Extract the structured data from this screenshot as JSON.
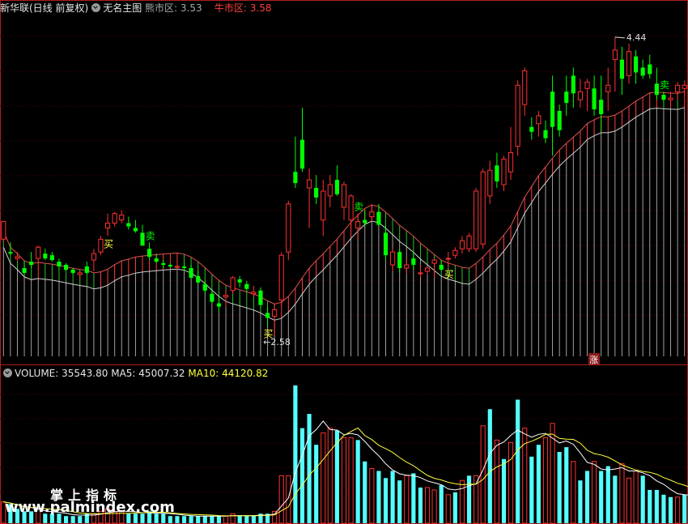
{
  "header": {
    "stock_title": "新华联(日线 前复权)",
    "main_indicator": "无名主图",
    "bear_label": "熊市区:",
    "bear_value": "3.53",
    "bull_label": "牛市区:",
    "bull_value": "3.58"
  },
  "volume_header": {
    "label": "VOLUME:",
    "value": "35543.80",
    "ma5_label": "MA5:",
    "ma5_value": "45007.32",
    "ma10_label": "MA10:",
    "ma10_value": "44120.82"
  },
  "watermark": {
    "line1": "掌上指标",
    "line2": "www.palmindex.com"
  },
  "colors": {
    "up": "#ff3232",
    "down": "#00ff00",
    "vol_down": "#54ffff",
    "ma5": "#ffffff",
    "ma10": "#ffff3c",
    "frame": "#b01e1e"
  },
  "chart_data": {
    "type": "candlestick",
    "price_range": [
      2.5,
      4.5
    ],
    "annotations": {
      "high_label": "4.44",
      "low_label": "2.58",
      "buy": "买",
      "sell": "卖",
      "rise": "涨"
    },
    "signals": [
      {
        "type": "buy",
        "bar": 15
      },
      {
        "type": "sell",
        "bar": 21
      },
      {
        "type": "buy",
        "bar": 38
      },
      {
        "type": "sell",
        "bar": 51
      },
      {
        "type": "buy",
        "bar": 64
      },
      {
        "type": "sell",
        "bar": 95
      }
    ],
    "rise_marker_bar": 85,
    "candles": [
      [
        3.18,
        3.29,
        3.16,
        3.29
      ],
      [
        3.1,
        3.16,
        3.08,
        3.09
      ],
      [
        3.06,
        3.1,
        3.04,
        3.07
      ],
      [
        3.0,
        3.04,
        2.96,
        2.97
      ],
      [
        3.04,
        3.1,
        3.0,
        3.02
      ],
      [
        3.06,
        3.14,
        3.03,
        3.13
      ],
      [
        3.09,
        3.12,
        3.05,
        3.06
      ],
      [
        3.08,
        3.1,
        3.04,
        3.05
      ],
      [
        3.04,
        3.06,
        2.99,
        3.01
      ],
      [
        3.02,
        3.03,
        2.98,
        2.99
      ],
      [
        2.99,
        3.0,
        2.96,
        2.97
      ],
      [
        2.96,
        2.98,
        2.93,
        2.97
      ],
      [
        3.01,
        3.04,
        2.96,
        2.97
      ],
      [
        3.05,
        3.12,
        2.98,
        3.09
      ],
      [
        3.1,
        3.2,
        3.08,
        3.18
      ],
      [
        3.25,
        3.34,
        3.2,
        3.28
      ],
      [
        3.28,
        3.35,
        3.26,
        3.34
      ],
      [
        3.3,
        3.36,
        3.28,
        3.33
      ],
      [
        3.28,
        3.32,
        3.24,
        3.26
      ],
      [
        3.25,
        3.3,
        3.22,
        3.23
      ],
      [
        3.22,
        3.27,
        3.18,
        3.14
      ],
      [
        3.12,
        3.16,
        3.05,
        3.07
      ],
      [
        3.06,
        3.09,
        3.03,
        3.04
      ],
      [
        3.03,
        3.05,
        3.0,
        3.02
      ],
      [
        3.02,
        3.03,
        3.0,
        3.01
      ],
      [
        3.01,
        3.02,
        2.99,
        3.01
      ],
      [
        3.01,
        3.03,
        2.98,
        3.0
      ],
      [
        3.0,
        3.02,
        2.93,
        2.94
      ],
      [
        2.95,
        2.98,
        2.9,
        2.91
      ],
      [
        2.9,
        2.92,
        2.84,
        2.86
      ],
      [
        2.84,
        2.87,
        2.78,
        2.79
      ],
      [
        2.78,
        2.82,
        2.73,
        2.76
      ],
      [
        2.82,
        2.86,
        2.76,
        2.83
      ],
      [
        2.86,
        2.95,
        2.84,
        2.94
      ],
      [
        2.93,
        2.95,
        2.88,
        2.91
      ],
      [
        2.9,
        2.92,
        2.85,
        2.87
      ],
      [
        2.84,
        2.89,
        2.82,
        2.85
      ],
      [
        2.86,
        2.88,
        2.75,
        2.77
      ],
      [
        2.72,
        2.76,
        2.64,
        2.69
      ],
      [
        2.7,
        2.78,
        2.58,
        2.74
      ],
      [
        2.8,
        3.1,
        2.76,
        3.08
      ],
      [
        3.1,
        3.42,
        3.05,
        3.4
      ],
      [
        3.6,
        3.82,
        3.5,
        3.53
      ],
      [
        3.8,
        4.0,
        3.6,
        3.62
      ],
      [
        3.5,
        3.62,
        3.25,
        3.55
      ],
      [
        3.5,
        3.58,
        3.4,
        3.44
      ],
      [
        3.3,
        3.55,
        3.2,
        3.48
      ],
      [
        3.45,
        3.58,
        3.38,
        3.52
      ],
      [
        3.55,
        3.64,
        3.45,
        3.46
      ],
      [
        3.38,
        3.54,
        3.3,
        3.52
      ],
      [
        3.3,
        3.46,
        3.24,
        3.45
      ],
      [
        3.25,
        3.34,
        3.18,
        3.29
      ],
      [
        3.3,
        3.36,
        3.26,
        3.28
      ],
      [
        3.32,
        3.4,
        3.29,
        3.35
      ],
      [
        3.35,
        3.4,
        3.26,
        3.27
      ],
      [
        3.22,
        3.27,
        3.05,
        3.08
      ],
      [
        3.02,
        3.12,
        2.98,
        3.1
      ],
      [
        3.1,
        3.12,
        2.97,
        3.0
      ],
      [
        3.0,
        3.05,
        2.96,
        3.02
      ],
      [
        3.06,
        3.1,
        2.99,
        3.02
      ],
      [
        2.97,
        3.02,
        2.94,
        2.97
      ],
      [
        2.98,
        3.01,
        2.96,
        3.0
      ],
      [
        3.03,
        3.06,
        2.94,
        3.05
      ],
      [
        3.02,
        3.05,
        2.98,
        2.99
      ],
      [
        3.06,
        3.1,
        3.01,
        3.06
      ],
      [
        3.08,
        3.13,
        3.06,
        3.11
      ],
      [
        3.12,
        3.2,
        3.09,
        3.17
      ],
      [
        3.12,
        3.22,
        3.1,
        3.2
      ],
      [
        3.12,
        3.5,
        3.1,
        3.48
      ],
      [
        3.15,
        3.62,
        3.12,
        3.6
      ],
      [
        3.45,
        3.67,
        3.4,
        3.61
      ],
      [
        3.64,
        3.72,
        3.5,
        3.54
      ],
      [
        3.52,
        3.7,
        3.48,
        3.68
      ],
      [
        3.6,
        3.88,
        3.55,
        3.72
      ],
      [
        3.76,
        4.17,
        3.7,
        4.14
      ],
      [
        4.02,
        4.25,
        3.95,
        4.23
      ],
      [
        3.88,
        3.94,
        3.8,
        3.85
      ],
      [
        3.9,
        3.98,
        3.82,
        3.95
      ],
      [
        3.86,
        3.92,
        3.78,
        3.81
      ],
      [
        4.1,
        4.2,
        3.7,
        3.88
      ],
      [
        3.98,
        4.02,
        3.82,
        3.86
      ],
      [
        4.1,
        4.2,
        3.95,
        4.03
      ],
      [
        4.2,
        4.25,
        4.0,
        4.09
      ],
      [
        4.05,
        4.18,
        4.0,
        4.1
      ],
      [
        4.12,
        4.18,
        3.98,
        4.16
      ],
      [
        4.12,
        4.2,
        3.95,
        3.99
      ],
      [
        4.05,
        4.2,
        3.85,
        3.96
      ],
      [
        4.1,
        4.25,
        3.98,
        4.14
      ],
      [
        4.3,
        4.44,
        4.1,
        4.36
      ],
      [
        4.3,
        4.38,
        4.08,
        4.18
      ],
      [
        4.2,
        4.4,
        4.15,
        4.35
      ],
      [
        4.32,
        4.36,
        4.15,
        4.22
      ],
      [
        4.25,
        4.3,
        4.18,
        4.2
      ],
      [
        4.27,
        4.33,
        4.18,
        4.21
      ],
      [
        4.15,
        4.25,
        4.05,
        4.08
      ],
      [
        4.08,
        4.1,
        4.03,
        4.05
      ],
      [
        4.05,
        4.1,
        4.0,
        4.06
      ],
      [
        4.1,
        4.16,
        4.05,
        4.14
      ],
      [
        4.12,
        4.17,
        4.08,
        4.14
      ]
    ],
    "volume": [
      {
        "v": 9,
        "up": true
      },
      {
        "v": 8,
        "up": false
      },
      {
        "v": 6,
        "up": false
      },
      {
        "v": 5,
        "up": false
      },
      {
        "v": 5,
        "up": false
      },
      {
        "v": 6,
        "up": true
      },
      {
        "v": 4,
        "up": false
      },
      {
        "v": 4,
        "up": false
      },
      {
        "v": 4,
        "up": false
      },
      {
        "v": 3,
        "up": false
      },
      {
        "v": 3,
        "up": false
      },
      {
        "v": 3,
        "up": false
      },
      {
        "v": 4,
        "up": false
      },
      {
        "v": 4,
        "up": true
      },
      {
        "v": 5,
        "up": true
      },
      {
        "v": 6,
        "up": true
      },
      {
        "v": 5,
        "up": true
      },
      {
        "v": 5,
        "up": true
      },
      {
        "v": 4,
        "up": false
      },
      {
        "v": 4,
        "up": false
      },
      {
        "v": 4,
        "up": false
      },
      {
        "v": 5,
        "up": false
      },
      {
        "v": 4,
        "up": false
      },
      {
        "v": 4,
        "up": false
      },
      {
        "v": 3,
        "up": false
      },
      {
        "v": 3,
        "up": false
      },
      {
        "v": 3,
        "up": false
      },
      {
        "v": 3,
        "up": false
      },
      {
        "v": 3,
        "up": false
      },
      {
        "v": 3,
        "up": false
      },
      {
        "v": 3,
        "up": false
      },
      {
        "v": 3,
        "up": false
      },
      {
        "v": 3,
        "up": true
      },
      {
        "v": 4,
        "up": true
      },
      {
        "v": 3,
        "up": false
      },
      {
        "v": 3,
        "up": false
      },
      {
        "v": 3,
        "up": false
      },
      {
        "v": 4,
        "up": false
      },
      {
        "v": 4,
        "up": false
      },
      {
        "v": 5,
        "up": true
      },
      {
        "v": 20,
        "up": true
      },
      {
        "v": 20,
        "up": true
      },
      {
        "v": 58,
        "up": false
      },
      {
        "v": 40,
        "up": false
      },
      {
        "v": 46,
        "up": false
      },
      {
        "v": 33,
        "up": false
      },
      {
        "v": 38,
        "up": true
      },
      {
        "v": 40,
        "up": true
      },
      {
        "v": 39,
        "up": false
      },
      {
        "v": 36,
        "up": true
      },
      {
        "v": 36,
        "up": true
      },
      {
        "v": 35,
        "up": false
      },
      {
        "v": 26,
        "up": false
      },
      {
        "v": 23,
        "up": true
      },
      {
        "v": 22,
        "up": false
      },
      {
        "v": 19,
        "up": false
      },
      {
        "v": 22,
        "up": false
      },
      {
        "v": 18,
        "up": false
      },
      {
        "v": 20,
        "up": true
      },
      {
        "v": 21,
        "up": false
      },
      {
        "v": 15,
        "up": false
      },
      {
        "v": 15,
        "up": true
      },
      {
        "v": 14,
        "up": true
      },
      {
        "v": 16,
        "up": false
      },
      {
        "v": 12,
        "up": true
      },
      {
        "v": 13,
        "up": false
      },
      {
        "v": 18,
        "up": true
      },
      {
        "v": 20,
        "up": false
      },
      {
        "v": 20,
        "up": true
      },
      {
        "v": 41,
        "up": true
      },
      {
        "v": 48,
        "up": false
      },
      {
        "v": 35,
        "up": true
      },
      {
        "v": 27,
        "up": false
      },
      {
        "v": 34,
        "up": true
      },
      {
        "v": 52,
        "up": false
      },
      {
        "v": 40,
        "up": true
      },
      {
        "v": 28,
        "up": false
      },
      {
        "v": 33,
        "up": false
      },
      {
        "v": 36,
        "up": true
      },
      {
        "v": 42,
        "up": true
      },
      {
        "v": 30,
        "up": false
      },
      {
        "v": 32,
        "up": false
      },
      {
        "v": 26,
        "up": true
      },
      {
        "v": 18,
        "up": false
      },
      {
        "v": 22,
        "up": false
      },
      {
        "v": 26,
        "up": true
      },
      {
        "v": 22,
        "up": false
      },
      {
        "v": 24,
        "up": false
      },
      {
        "v": 20,
        "up": false
      },
      {
        "v": 25,
        "up": true
      },
      {
        "v": 19,
        "up": true
      },
      {
        "v": 22,
        "up": true
      },
      {
        "v": 20,
        "up": false
      },
      {
        "v": 14,
        "up": false
      },
      {
        "v": 14,
        "up": false
      },
      {
        "v": 12,
        "up": false
      },
      {
        "v": 11,
        "up": false
      },
      {
        "v": 11,
        "up": true
      },
      {
        "v": 12,
        "up": false
      },
      {
        "v": 13,
        "up": false
      }
    ]
  }
}
